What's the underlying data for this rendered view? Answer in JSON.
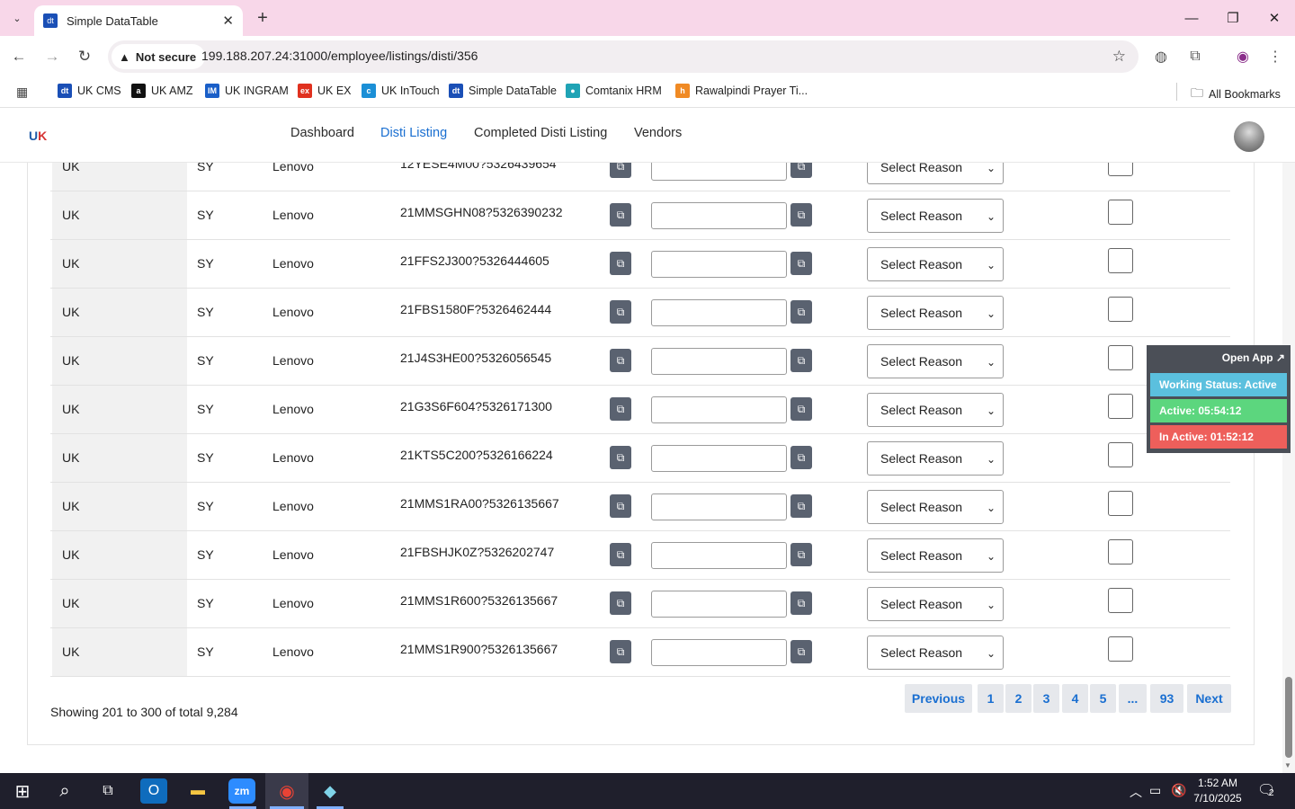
{
  "browser": {
    "tab_title": "Simple DataTable",
    "tab_favicon": "dt",
    "new_tab": "+",
    "not_secure": "Not secure",
    "url": "199.188.207.24:31000/employee/listings/disti/356",
    "bookmarks": [
      {
        "label": "UK CMS",
        "icon": "dt",
        "color": "#1a4fb6"
      },
      {
        "label": "UK AMZ",
        "icon": "a",
        "color": "#111111"
      },
      {
        "label": "UK INGRAM",
        "icon": "IM",
        "color": "#1a5fc8"
      },
      {
        "label": "UK EX",
        "icon": "ex",
        "color": "#e0311f"
      },
      {
        "label": "UK InTouch",
        "icon": "c",
        "color": "#1b8fd6"
      },
      {
        "label": "Simple DataTable",
        "icon": "dt",
        "color": "#1a4fb6"
      },
      {
        "label": "Comtanix HRM",
        "icon": "●",
        "color": "#1fa3b5"
      },
      {
        "label": "Rawalpindi Prayer Ti...",
        "icon": "h",
        "color": "#f08a24"
      }
    ],
    "all_bookmarks": "All Bookmarks"
  },
  "nav": {
    "items": [
      "Dashboard",
      "Disti Listing",
      "Completed Disti Listing",
      "Vendors"
    ],
    "active": "Disti Listing"
  },
  "table": {
    "select_placeholder": "Select Reason",
    "rows": [
      {
        "country": "UK",
        "code": "SY",
        "brand": "Lenovo",
        "part": "12YESE4M00?5326439654"
      },
      {
        "country": "UK",
        "code": "SY",
        "brand": "Lenovo",
        "part": "21MMSGHN08?5326390232"
      },
      {
        "country": "UK",
        "code": "SY",
        "brand": "Lenovo",
        "part": "21FFS2J300?5326444605"
      },
      {
        "country": "UK",
        "code": "SY",
        "brand": "Lenovo",
        "part": "21FBS1580F?5326462444"
      },
      {
        "country": "UK",
        "code": "SY",
        "brand": "Lenovo",
        "part": "21J4S3HE00?5326056545"
      },
      {
        "country": "UK",
        "code": "SY",
        "brand": "Lenovo",
        "part": "21G3S6F604?5326171300"
      },
      {
        "country": "UK",
        "code": "SY",
        "brand": "Lenovo",
        "part": "21KTS5C200?5326166224"
      },
      {
        "country": "UK",
        "code": "SY",
        "brand": "Lenovo",
        "part": "21MMS1RA00?5326135667"
      },
      {
        "country": "UK",
        "code": "SY",
        "brand": "Lenovo",
        "part": "21FBSHJK0Z?5326202747"
      },
      {
        "country": "UK",
        "code": "SY",
        "brand": "Lenovo",
        "part": "21MMS1R600?5326135667"
      },
      {
        "country": "UK",
        "code": "SY",
        "brand": "Lenovo",
        "part": "21MMS1R900?5326135667"
      }
    ],
    "showing": "Showing 201 to 300 of total 9,284",
    "pagination": [
      "Previous",
      "1",
      "2",
      "3",
      "4",
      "5",
      "...",
      "93",
      "Next"
    ]
  },
  "widget": {
    "open_app": "Open App ↗",
    "working_status": "Working Status: Active",
    "active": "Active: 05:54:12",
    "inactive": "In Active: 01:52:12",
    "colors": {
      "status": "#5bc0de",
      "active": "#5cd67e",
      "inactive": "#ee5f5b"
    }
  },
  "taskbar": {
    "time": "1:52 AM",
    "date": "7/10/2025",
    "notifications": "2"
  }
}
